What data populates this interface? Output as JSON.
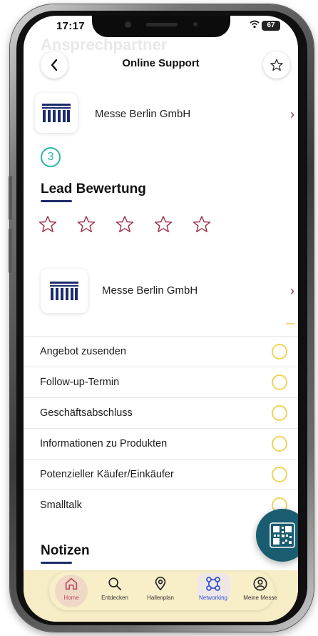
{
  "status": {
    "time": "17:17",
    "battery": "67"
  },
  "ghost_header": "Ansprechpartner",
  "nav": {
    "title": "Online Support"
  },
  "exhibitor_top": {
    "name": "Messe Berlin GmbH"
  },
  "step": "3",
  "lead": {
    "title": "Lead Bewertung",
    "rating": 0,
    "max": 5
  },
  "exhibitor_second": {
    "name": "Messe Berlin GmbH"
  },
  "checklist": [
    {
      "label": "Angebot zusenden",
      "checked": false
    },
    {
      "label": "Follow-up-Termin",
      "checked": false
    },
    {
      "label": "Geschäftsabschluss",
      "checked": false
    },
    {
      "label": "Informationen zu Produkten",
      "checked": false
    },
    {
      "label": "Potenzieller Käufer/Einkäufer",
      "checked": false
    },
    {
      "label": "Smalltalk",
      "checked": false
    }
  ],
  "notes": {
    "title": "Notizen"
  },
  "tabs": [
    {
      "label": "Home",
      "icon": "home-icon"
    },
    {
      "label": "Entdecken",
      "icon": "search-icon"
    },
    {
      "label": "Hallenplan",
      "icon": "location-pin-icon"
    },
    {
      "label": "Networking",
      "icon": "network-icon"
    },
    {
      "label": "Meine Messe",
      "icon": "user-icon"
    }
  ],
  "colors": {
    "accent": "#9b2b45",
    "teal": "#2bb7a6",
    "navy": "#1b2b6b",
    "radio": "#efd35a",
    "tabbar": "#f6ecc6",
    "fab": "#1a5c70"
  }
}
